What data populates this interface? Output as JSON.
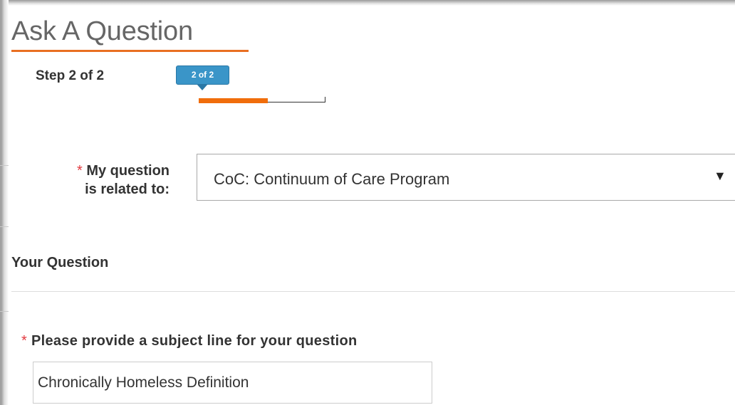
{
  "page": {
    "title": "Ask A Question"
  },
  "steps": {
    "label": "Step 2 of 2",
    "badge": "2 of 2",
    "progress_fraction": 0.55
  },
  "form": {
    "required_marker": "*",
    "related_label_line1": "My question",
    "related_label_line2": "is related to:",
    "related_value": "CoC: Continuum of Care Program",
    "related_arrow": "▼",
    "section_heading": "Your Question",
    "subject_label": "Please provide a subject line for your question",
    "subject_value": "Chronically Homeless Definition"
  },
  "colors": {
    "accent_orange": "#f06d0b",
    "badge_blue": "#3a95c8",
    "required_red": "#e2393f"
  }
}
